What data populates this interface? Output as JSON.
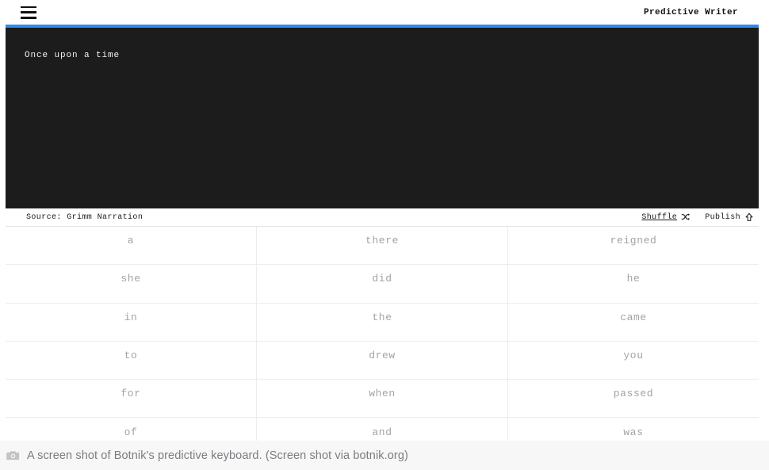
{
  "header": {
    "menu_icon": "hamburger-menu-icon",
    "title": "Predictive Writer"
  },
  "editor": {
    "text": "Once upon a time",
    "accent_color": "#2d8cf0",
    "background_color": "#1c1c1c",
    "text_color": "#f2f2f2"
  },
  "source_bar": {
    "source_label": "Source: Grimm Narration",
    "shuffle_label": "Shuffle",
    "shuffle_icon": "shuffle-icon",
    "publish_label": "Publish",
    "publish_icon": "arrow-up-icon"
  },
  "suggestions": {
    "rows": [
      [
        "a",
        "there",
        "reigned"
      ],
      [
        "she",
        "did",
        "he"
      ],
      [
        "in",
        "the",
        "came"
      ],
      [
        "to",
        "drew",
        "you"
      ],
      [
        "for",
        "when",
        "passed"
      ],
      [
        "of",
        "and",
        "was"
      ]
    ],
    "text_color": "#a3a3a3"
  },
  "caption": {
    "icon": "camera-icon",
    "text": "A screen shot of Botnik's predictive keyboard. (Screen shot via botnik.org)",
    "background_color": "#f7f7f8",
    "text_color": "#7c7c80"
  }
}
